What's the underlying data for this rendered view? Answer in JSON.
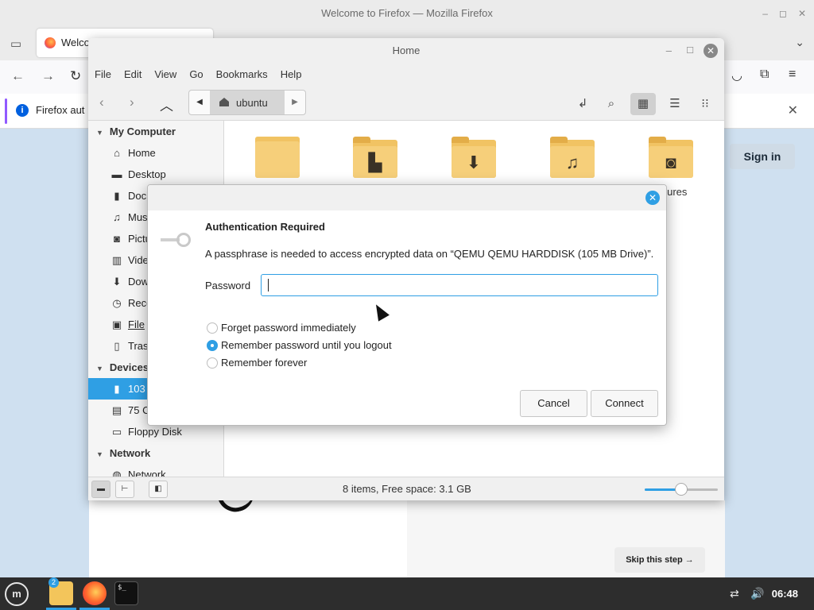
{
  "firefox": {
    "window_title": "Welcome to Firefox — Mozilla Firefox",
    "tab_label": "Welco",
    "notice_text": "Firefox aut",
    "sign_in": "Sign in",
    "skip_step": "Skip this step →"
  },
  "nemo": {
    "title": "Home",
    "menu": [
      "File",
      "Edit",
      "View",
      "Go",
      "Bookmarks",
      "Help"
    ],
    "breadcrumb": "ubuntu",
    "sidebar": {
      "my_computer_header": "My Computer",
      "my_computer": [
        {
          "label": "Home",
          "icon": "home-icon"
        },
        {
          "label": "Desktop",
          "icon": "desktop-icon"
        },
        {
          "label": "Doc",
          "icon": "document-icon"
        },
        {
          "label": "Mus",
          "icon": "music-icon"
        },
        {
          "label": "Pictu",
          "icon": "camera-icon"
        },
        {
          "label": "Vide",
          "icon": "video-icon"
        },
        {
          "label": "Dow",
          "icon": "download-icon"
        },
        {
          "label": "Rece",
          "icon": "recent-icon"
        },
        {
          "label": "File",
          "icon": "filesystem-icon"
        },
        {
          "label": "Tras",
          "icon": "trash-icon"
        }
      ],
      "devices_header": "Devices",
      "devices": [
        {
          "label": "103",
          "icon": "usb-drive-icon",
          "selected": true
        },
        {
          "label": "75 C",
          "icon": "disk-icon",
          "selected": false
        },
        {
          "label": "Floppy Disk",
          "icon": "floppy-icon",
          "selected": false
        }
      ],
      "network_header": "Network",
      "network": [
        {
          "label": "Network",
          "icon": "network-icon"
        }
      ]
    },
    "files": {
      "pictures_label": "ctures"
    },
    "status_text": "8 items, Free space: 3.1 GB",
    "zoom_level": 0.5
  },
  "dialog": {
    "title": "Authentication Required",
    "message": "A passphrase is needed to access encrypted data on “QEMU QEMU HARDDISK (105 MB Drive)”.",
    "password_label": "Password",
    "password_value": "",
    "options": [
      {
        "label": "Forget password immediately",
        "selected": false
      },
      {
        "label": "Remember password until you logout",
        "selected": true
      },
      {
        "label": "Remember forever",
        "selected": false
      }
    ],
    "cancel": "Cancel",
    "connect": "Connect"
  },
  "taskbar": {
    "files_badge": "2",
    "terminal_glyph": "$_",
    "clock": "06:48"
  },
  "colors": {
    "accent": "#2f9fe4",
    "folder": "#f6cf7a"
  }
}
